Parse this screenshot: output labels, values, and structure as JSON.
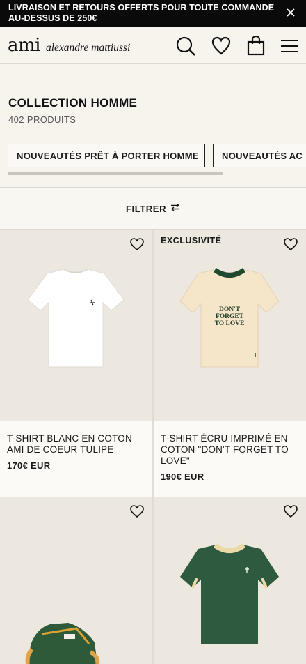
{
  "promo": {
    "text": "LIVRAISON ET RETOURS OFFERTS POUR TOUTE COMMANDE AU-DESSUS DE 250€",
    "close_icon": "close-icon"
  },
  "header": {
    "logo_mark": "ami",
    "logo_name": "alexandre mattiussi",
    "icons": [
      "search-icon",
      "heart-icon",
      "bag-icon",
      "menu-icon"
    ]
  },
  "collection": {
    "title": "COLLECTION HOMME",
    "count": "402 PRODUITS"
  },
  "chips": [
    {
      "label": "NOUVEAUTÉS PRÊT À PORTER HOMME"
    },
    {
      "label": "NOUVEAUTÉS AC"
    }
  ],
  "filter": {
    "label": "FILTRER",
    "icon": "filter-arrows-icon"
  },
  "products": [
    {
      "name": "T-SHIRT BLANC EN COTON AMI DE COEUR TULIPE",
      "price": "170€ EUR",
      "badge": "",
      "image": "white-tshirt",
      "color": "#ffffff"
    },
    {
      "name": "T-SHIRT ÉCRU IMPRIMÉ EN COTON \"DON'T FORGET TO LOVE\"",
      "price": "190€ EUR",
      "badge": "EXCLUSIVITÉ",
      "image": "ecru-tshirt",
      "color": "#f6e6c9",
      "print_text": "DON'T FORGET TO LOVE"
    },
    {
      "name": "",
      "price": "",
      "badge": "",
      "image": "green-sneaker",
      "color": "#2f5a3a"
    },
    {
      "name": "",
      "price": "",
      "badge": "",
      "image": "green-tshirt",
      "color": "#2e5a3f"
    }
  ],
  "colors": {
    "accent": "#0a0a0a",
    "background": "#f7f4ee",
    "image_bg": "#ece7df"
  }
}
